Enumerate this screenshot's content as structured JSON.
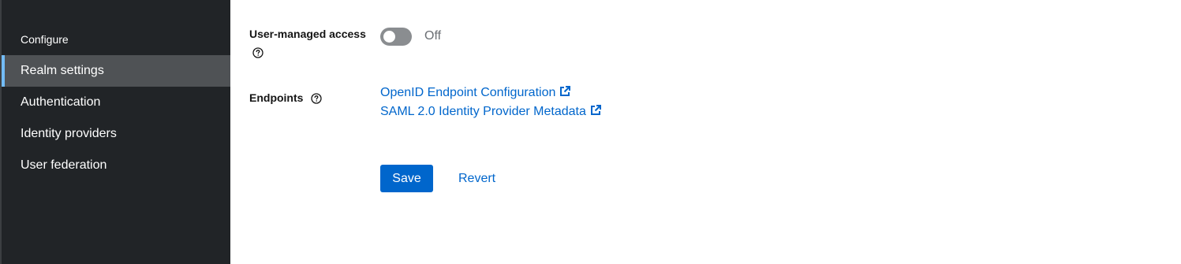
{
  "sidebar": {
    "section_title": "Configure",
    "items": [
      {
        "label": "Realm settings",
        "active": true
      },
      {
        "label": "Authentication",
        "active": false
      },
      {
        "label": "Identity providers",
        "active": false
      },
      {
        "label": "User federation",
        "active": false
      }
    ]
  },
  "form": {
    "user_managed_access": {
      "label": "User-managed access",
      "help_icon": "question-circle-icon",
      "value": false,
      "state_label": "Off"
    },
    "endpoints": {
      "label": "Endpoints",
      "help_icon": "question-circle-icon",
      "links": [
        {
          "label": "OpenID Endpoint Configuration",
          "icon": "external-link-icon"
        },
        {
          "label": "SAML 2.0 Identity Provider Metadata",
          "icon": "external-link-icon"
        }
      ]
    }
  },
  "actions": {
    "save_label": "Save",
    "revert_label": "Revert"
  },
  "colors": {
    "sidebar_bg": "#212427",
    "sidebar_active_bg": "#4f5255",
    "sidebar_active_accent": "#73bcf7",
    "primary": "#0066cc",
    "toggle_off": "#8a8d90"
  }
}
